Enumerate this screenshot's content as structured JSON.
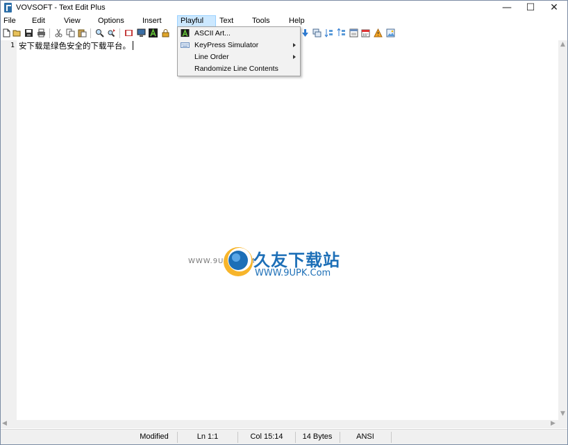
{
  "window": {
    "title": "VOVSOFT - Text Edit Plus"
  },
  "titlebar_buttons": {
    "minimize": "—",
    "maximize": "☐",
    "close": "✕"
  },
  "menubar": {
    "items": [
      {
        "label": "File"
      },
      {
        "label": "Edit"
      },
      {
        "label": "View"
      },
      {
        "label": "Options"
      },
      {
        "label": "Insert"
      },
      {
        "label": "Playful",
        "active": true
      },
      {
        "label": "Text"
      },
      {
        "label": "Tools"
      },
      {
        "label": "Help"
      }
    ]
  },
  "toolbar": {
    "icons": [
      "new-file-icon",
      "open-folder-icon",
      "save-icon",
      "print-icon",
      "cut-icon",
      "copy-icon",
      "paste-icon",
      "find-icon",
      "replace-icon",
      "book-icon",
      "monitor-icon",
      "ascii-art-icon",
      "lock-icon",
      "arrow-down-icon",
      "window-copy-icon",
      "sort-icon",
      "sort-lines-icon",
      "list-icon",
      "calendar-icon",
      "warning-icon",
      "image-icon"
    ]
  },
  "playful_menu": {
    "items": [
      {
        "label": "ASCII Art...",
        "has_submenu": false,
        "icon": "ascii-art-icon"
      },
      {
        "label": "KeyPress Simulator",
        "has_submenu": true,
        "icon": "keyboard-icon"
      },
      {
        "label": "Line Order",
        "has_submenu": true
      },
      {
        "label": "Randomize Line Contents",
        "has_submenu": false
      }
    ]
  },
  "editor": {
    "line_number": "1",
    "text": "安下载是绿色安全的下载平台。"
  },
  "watermark": {
    "left_text": "WWW.9UPK.COM",
    "title": "久友下载站",
    "url": "WWW.9UPK.Com"
  },
  "statusbar": {
    "modified": "Modified",
    "line": "Ln 1:1",
    "column": "Col 15:14",
    "size": "14 Bytes",
    "encoding": "ANSI"
  },
  "colors": {
    "menu_active_bg": "#cce8ff",
    "menu_active_border": "#99d1ff",
    "watermark_blue": "#1d6fb7",
    "accent_orange": "#f6a623"
  }
}
